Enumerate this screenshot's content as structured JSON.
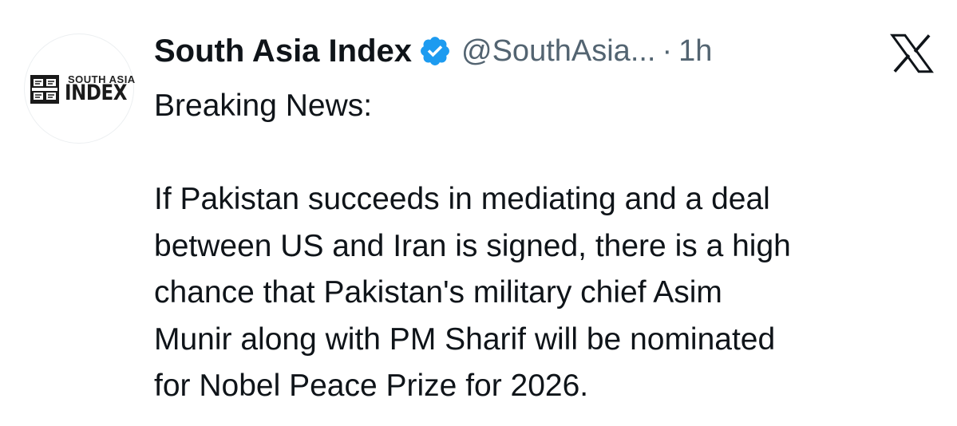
{
  "tweet": {
    "display_name": "South Asia Index",
    "handle": "@SouthAsia...",
    "separator": "·",
    "time": "1h",
    "avatar": {
      "small_text": "SOUTH ASIA",
      "big_text": "INDEX"
    },
    "verified_color": "#1d9bf0",
    "body": {
      "headline": "Breaking News:",
      "lines": [
        "If Pakistan succeeds in mediating and a deal",
        "between US and Iran is signed, there is a high",
        "chance that Pakistan's military chief Asim",
        "Munir along with PM Sharif will be nominated",
        "for Nobel Peace Prize for 2026."
      ]
    }
  },
  "icons": {
    "verified": "verified-badge-icon",
    "platform": "x-logo-icon",
    "avatar_logo": "south-asia-index-logo-icon"
  }
}
